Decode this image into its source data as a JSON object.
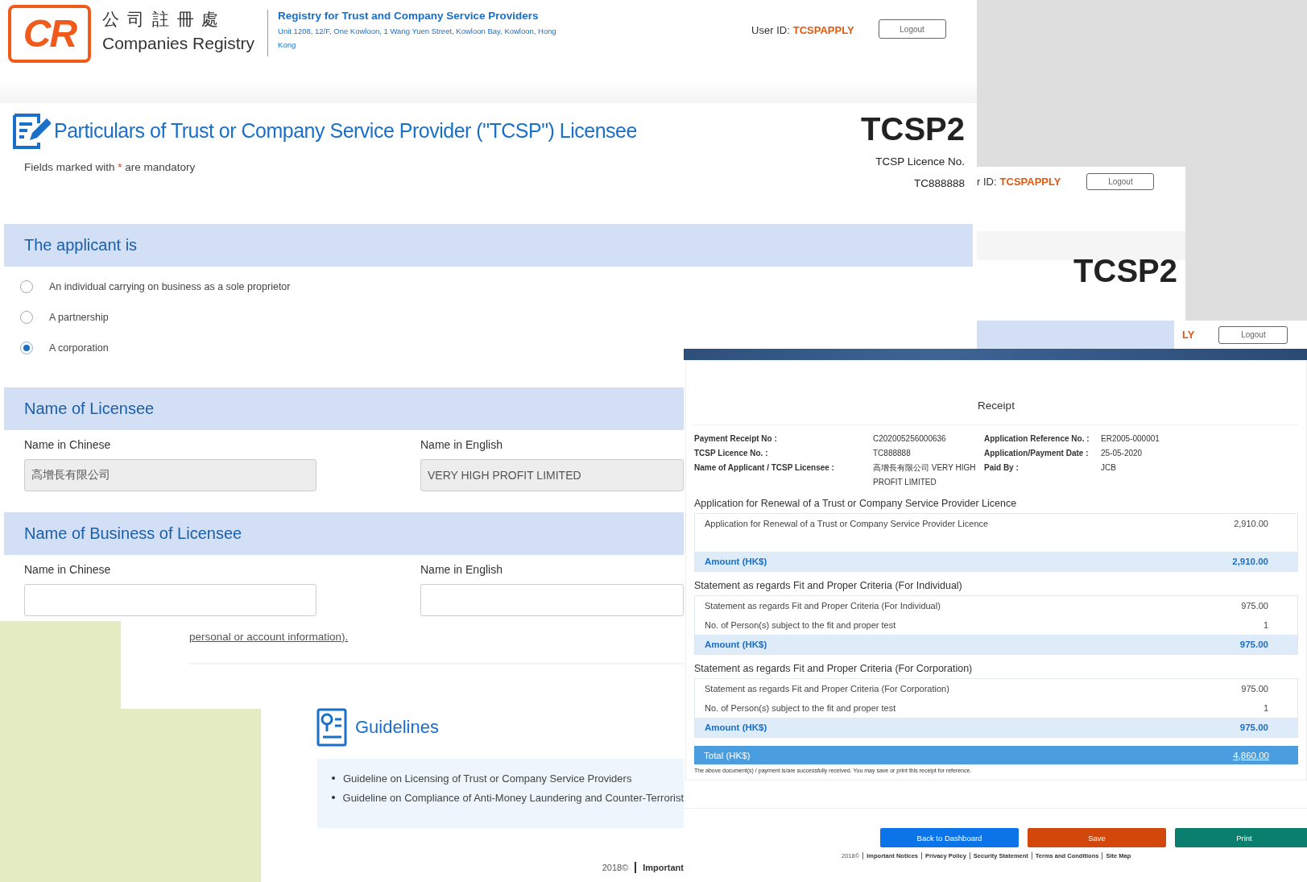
{
  "main_window": {
    "header": {
      "logo": "CR",
      "org_name_chinese": "公 司 註 冊 處",
      "org_name": "Companies Registry",
      "registry_title": "Registry for Trust and Company Service Providers",
      "address": "Unit 1208, 12/F, One Kowloon, 1 Wang Yuen Street, Kowloon Bay, Kowloon, Hong Kong",
      "user_id_label": "User ID:",
      "user_id": "TCSPAPPLY",
      "logout": "Logout"
    },
    "page_title": "Particulars of Trust or Company Service Provider (\"TCSP\") Licensee",
    "mandatory_note": {
      "before": "Fields marked with",
      "mark": "*",
      "after": "are mandatory"
    },
    "form_code": "TCSP2",
    "licence_label": "TCSP Licence No.",
    "licence_no": "TC888888",
    "applicant_section": {
      "title": "The applicant is",
      "options": [
        {
          "label": "An individual carrying on business as a sole proprietor",
          "selected": false
        },
        {
          "label": "A partnership",
          "selected": false
        },
        {
          "label": "A corporation",
          "selected": true
        }
      ]
    },
    "licensee_name_section": {
      "title": "Name of Licensee",
      "fields": [
        {
          "label": "Name in Chinese",
          "value": "高增長有限公司",
          "disabled": true
        },
        {
          "label": "Name in English",
          "value": "VERY HIGH PROFIT LIMITED",
          "disabled": true
        }
      ]
    },
    "business_name_section": {
      "title": "Name of Business of Licensee",
      "fields": [
        {
          "label": "Name in Chinese",
          "disabled": false
        },
        {
          "label": "Name in English",
          "disabled": false
        }
      ]
    }
  },
  "second_window": {
    "user_id_label": "r ID:",
    "user_id": "TCSPAPPLY",
    "logout": "Logout",
    "form_code": "TCSP2"
  },
  "third_window": {
    "user_id": "LY",
    "logout": "Logout"
  },
  "receipt_window": {
    "title": "Receipt",
    "details_left": [
      {
        "label": "Payment Receipt No :",
        "value": "C202005256000636"
      },
      {
        "label": "TCSP Licence No. :",
        "value": "TC888888"
      },
      {
        "label": "Name of Applicant / TCSP Licensee :",
        "value": "高增長有限公司 VERY HIGH PROFIT LIMITED"
      }
    ],
    "details_right": [
      {
        "label": "Application Reference No. :",
        "value": "ER2005-000001"
      },
      {
        "label": "Application/Payment Date :",
        "value": "25-05-2020"
      },
      {
        "label": "Paid By :",
        "value": "JCB"
      }
    ],
    "sections": [
      {
        "title": "Application for Renewal of a Trust or Company Service Provider Licence",
        "lines": [
          {
            "label": "Application for Renewal of a Trust or Company Service Provider Licence",
            "value": "2,910.00"
          }
        ],
        "amount_label": "Amount (HK$)",
        "amount": "2,910.00"
      },
      {
        "title": "Statement as regards Fit and Proper Criteria (For Individual)",
        "lines": [
          {
            "label": "Statement as regards Fit and Proper Criteria (For Individual)",
            "value": "975.00"
          },
          {
            "label": "No. of Person(s) subject to the fit and proper test",
            "value": "1"
          }
        ],
        "amount_label": "Amount (HK$)",
        "amount": "975.00"
      },
      {
        "title": "Statement as regards Fit and Proper Criteria (For Corporation)",
        "lines": [
          {
            "label": "Statement as regards Fit and Proper Criteria (For Corporation)",
            "value": "975.00"
          },
          {
            "label": "No. of Person(s) subject to the fit and proper test",
            "value": "1"
          }
        ],
        "amount_label": "Amount (HK$)",
        "amount": "975.00"
      }
    ],
    "total": {
      "label": "Total (HK$)",
      "value": "4,860.00"
    },
    "note": "The above document(s) / payment is/are successfully received. You may save or print this receipt for reference.",
    "buttons": [
      {
        "label": "Back to Dashboard",
        "kind": "primary"
      },
      {
        "label": "Save",
        "kind": "warning"
      },
      {
        "label": "Print",
        "kind": "success"
      }
    ],
    "footer": {
      "copyright": "2018©",
      "links": [
        "Important Notices",
        "Privacy Policy",
        "Security Statement",
        "Terms and Conditions",
        "Site Map"
      ]
    }
  },
  "guidelines_window": {
    "link_text": "personal or account information).",
    "title": "Guidelines",
    "items": [
      "Guideline on Licensing of Trust or Company Service Providers",
      "Guideline on Compliance of Anti-Money Laundering and Counter-Terrorist"
    ],
    "footer": {
      "copyright": "2018©",
      "links": [
        "Important"
      ]
    }
  }
}
